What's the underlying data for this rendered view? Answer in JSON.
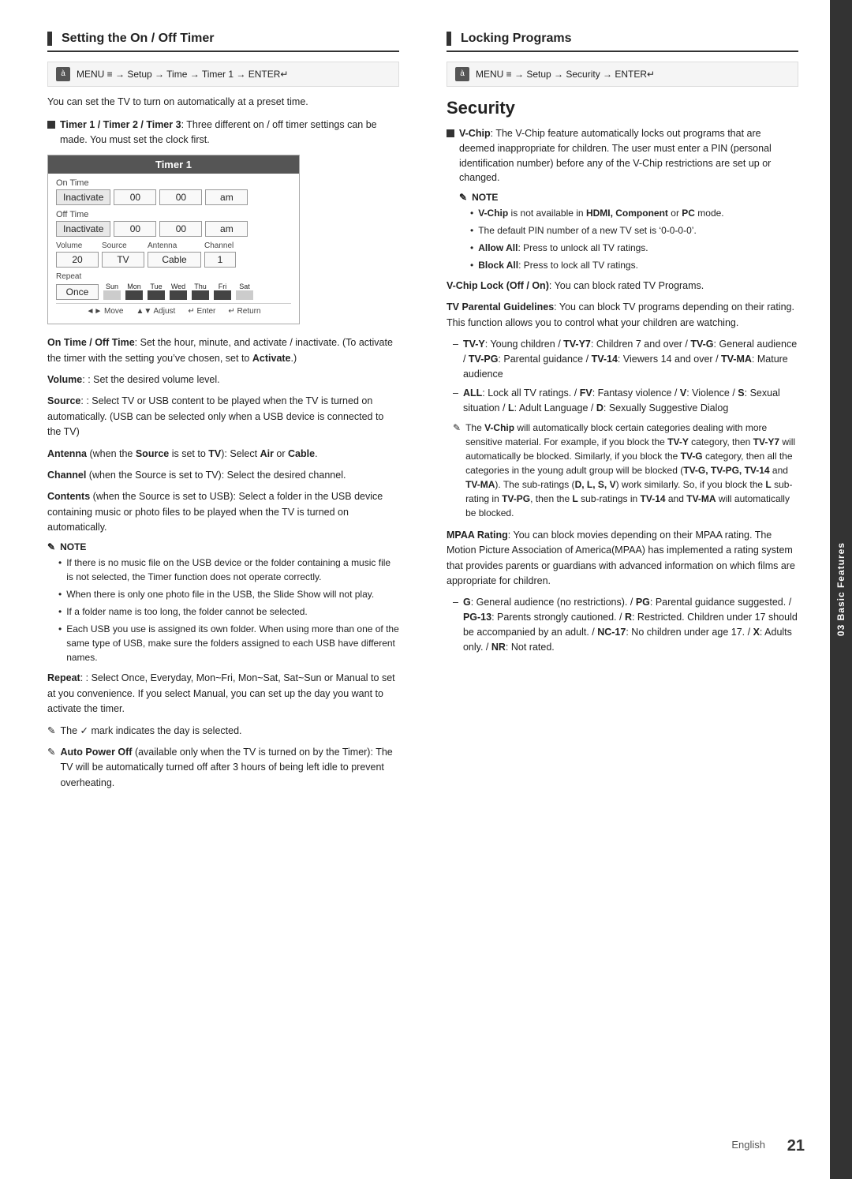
{
  "sidebar": {
    "label": "03 Basic Features"
  },
  "left": {
    "section_title": "Setting the On / Off Timer",
    "menu_path": "MENU ≡ → Setup → Time → Timer 1 → ENTER↵",
    "intro_text": "You can set the TV to turn on automatically at a preset time.",
    "bullet1_label": "Timer 1 / Timer 2 / Timer 3",
    "bullet1_text": ": Three different on / off timer settings can be made. You must set the clock first.",
    "timer_title": "Timer 1",
    "timer_on_label": "On Time",
    "timer_off_label": "Off Time",
    "inactivate": "Inactivate",
    "time_00a": "00",
    "time_00b": "00",
    "time_am_a": "am",
    "time_00c": "00",
    "time_00d": "00",
    "time_am_b": "am",
    "volume_label": "Volume",
    "source_label": "Source",
    "antenna_label": "Antenna",
    "channel_label": "Channel",
    "volume_val": "20",
    "source_val": "TV",
    "antenna_val": "Cable",
    "channel_val": "1",
    "repeat_label": "Repeat",
    "once_val": "Once",
    "day_sun": "Sun",
    "day_mon": "Mon",
    "day_tue": "Tue",
    "day_wed": "Wed",
    "day_thu": "Thu",
    "day_fri": "Fri",
    "day_sat": "Sat",
    "nav_move": "◄► Move",
    "nav_adjust": "▲▼ Adjust",
    "nav_enter": "↵ Enter",
    "nav_return": "↵ Return",
    "on_off_time_label": "On Time / Off Time",
    "on_off_time_desc": ": Set the hour, minute, and activate / inactivate. (To activate the timer with the setting you’ve chosen, set to",
    "activate_word": "Activate",
    "on_off_time_end": ".)",
    "volume_desc_label": "Volume",
    "volume_desc": ": Set the desired volume level.",
    "source_desc_label": "Source",
    "source_desc": ": Select TV or USB content to be played when the TV is turned on automatically. (USB can be selected only when a USB device is connected to the TV)",
    "antenna_desc_label": "Antenna",
    "antenna_desc_prefix": "(when the",
    "antenna_source_word": "Source",
    "antenna_desc_mid": "is set to",
    "antenna_tv_word": "TV",
    "antenna_desc_suffix": "): Select",
    "antenna_air": "Air",
    "antenna_or": "or",
    "antenna_cable": "Cable",
    "channel_desc_label": "Channel",
    "channel_desc": "(when the Source is set to TV): Select the desired channel.",
    "contents_label": "Contents",
    "contents_desc": "(when the Source is set to USB): Select a folder in the USB device containing music or photo files to be played when the TV is turned on automatically.",
    "note_label": "NOTE",
    "note1": "If there is no music file on the USB device or the folder containing a music file is not selected, the Timer function does not operate correctly.",
    "note2": "When there is only one photo file in the USB, the Slide Show will not play.",
    "note3": "If a folder name is too long, the folder cannot be selected.",
    "note4": "Each USB you use is assigned its own folder. When using more than one of the same type of USB, make sure the folders assigned to each USB have different names.",
    "repeat_desc_label": "Repeat",
    "repeat_desc": ": Select Once, Everyday, Mon~Fri, Mon~Sat, Sat~Sun or Manual to set at you convenience. If you select Manual, you can set up the day you want to activate the timer.",
    "checkmark_note": "The ✓ mark indicates the day is selected.",
    "auto_power_label": "Auto Power Off",
    "auto_power_desc": "(available only when the TV is turned on by the Timer): The TV will be automatically turned off after 3 hours of being left idle to prevent overheating."
  },
  "right": {
    "section_title": "Locking Programs",
    "menu_path": "MENU ≡ → Setup → Security → ENTER↵",
    "security_heading": "Security",
    "vchip_label": "V-Chip",
    "vchip_desc": ": The V-Chip feature automatically locks out programs that are deemed inappropriate for children. The user must enter a PIN (personal identification number) before any of the V-Chip restrictions are set up or changed.",
    "note_label": "NOTE",
    "note1": "V-Chip is not available in HDMI, Component or PC mode.",
    "note2": "The default PIN number of a new TV set is ‘0-0-0-0’.",
    "note3": "Allow All: Press to unlock all TV ratings.",
    "note4": "Block All: Press to lock all TV ratings.",
    "vchip_lock_label": "V-Chip Lock (Off / On)",
    "vchip_lock_desc": ": You can block rated TV Programs.",
    "tv_parental_label": "TV Parental Guidelines",
    "tv_parental_desc": ": You can block TV programs depending on their rating. This function allows you to control what your children are watching.",
    "dash1": "TV-Y: Young children / TV-Y7: Children 7 and over / TV-G: General audience / TV-PG: Parental guidance / TV-14: Viewers 14 and over / TV-MA: Mature audience",
    "dash2": "ALL: Lock all TV ratings. / FV: Fantasy violence / V: Violence / S: Sexual situation / L: Adult Language / D: Sexually Suggestive Dialog",
    "vchip_auto_note": "The V-Chip will automatically block certain categories dealing with more sensitive material. For example, if you block the TV-Y category, then TV-Y7 will automatically be blocked. Similarly, if you block the TV-G category, then all the categories in the young adult group will be blocked (TV-G, TV-PG, TV-14 and TV-MA). The sub-ratings (D, L, S, V) work similarly. So, if you block the L sub-rating in TV-PG, then the L sub-ratings in TV-14 and TV-MA will automatically be blocked.",
    "mpaa_label": "MPAA Rating",
    "mpaa_desc": ": You can block movies depending on their MPAA rating. The Motion Picture Association of America(MPAA) has implemented a rating system that provides parents or guardians with advanced information on which films are appropriate for children.",
    "mpaa_dash": "G: General audience (no restrictions). / PG: Parental guidance suggested. / PG-13: Parents strongly cautioned. / R: Restricted. Children under 17 should be accompanied by an adult. / NC-17: No children under age 17. / X: Adults only. / NR: Not rated.",
    "the_text": "The"
  },
  "page": {
    "lang": "English",
    "number": "21"
  }
}
